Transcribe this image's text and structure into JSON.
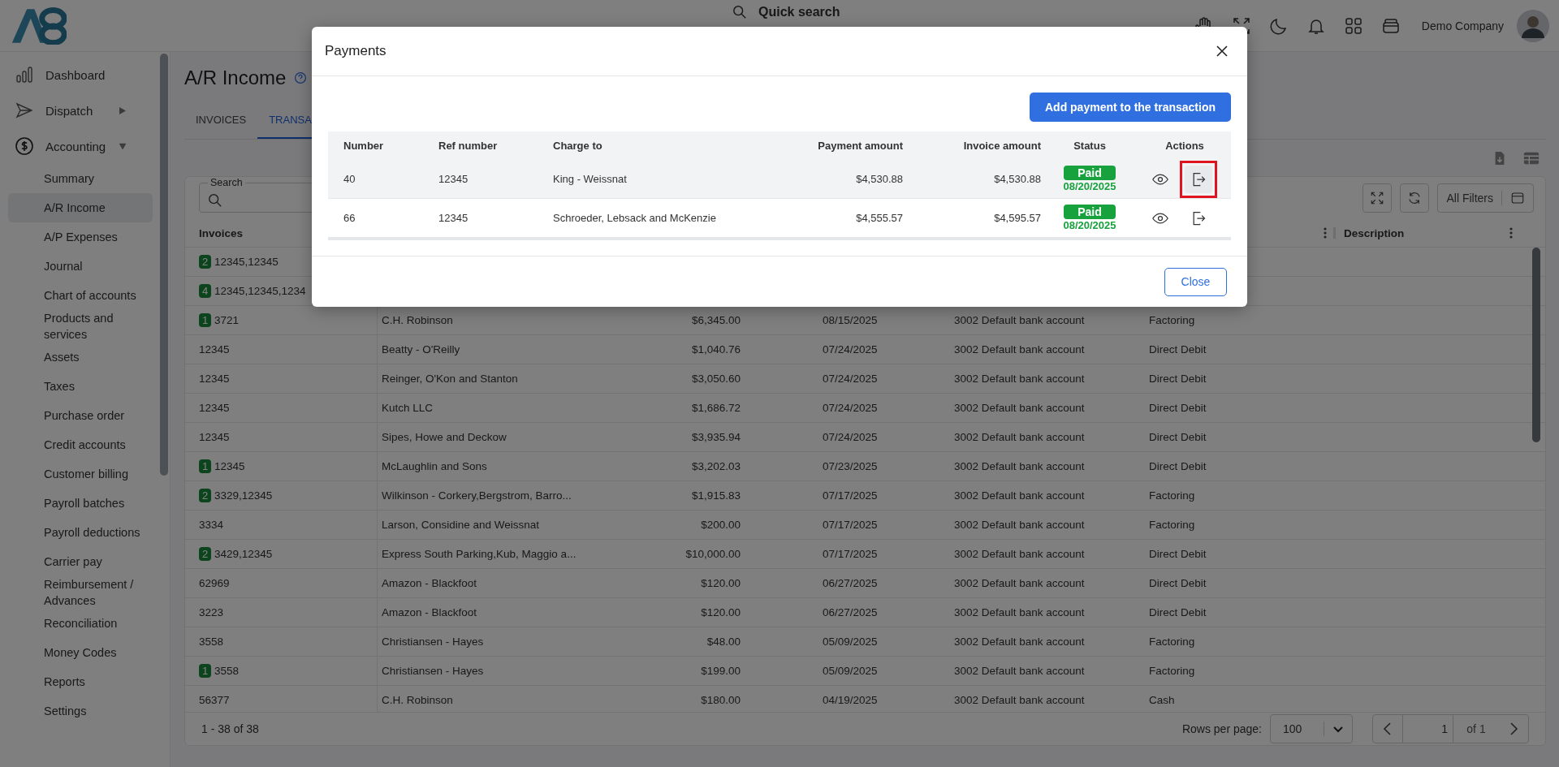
{
  "topbar": {
    "search_placeholder": "Quick search",
    "company": "Demo Company"
  },
  "sidebar": {
    "items": [
      {
        "label": "Dashboard"
      },
      {
        "label": "Dispatch",
        "expanded": false
      },
      {
        "label": "Accounting",
        "expanded": true,
        "children": [
          {
            "label": "Summary",
            "selected": false
          },
          {
            "label": "A/R Income",
            "selected": true
          },
          {
            "label": "A/P Expenses",
            "selected": false
          },
          {
            "label": "Journal",
            "selected": false
          },
          {
            "label": "Chart of accounts",
            "selected": false
          },
          {
            "label": "Products and services",
            "selected": false
          },
          {
            "label": "Assets",
            "selected": false
          },
          {
            "label": "Taxes",
            "selected": false
          },
          {
            "label": "Purchase order",
            "selected": false
          },
          {
            "label": "Credit accounts",
            "selected": false
          },
          {
            "label": "Customer billing",
            "selected": false
          },
          {
            "label": "Payroll batches",
            "selected": false
          },
          {
            "label": "Payroll deductions",
            "selected": false
          },
          {
            "label": "Carrier pay",
            "selected": false
          },
          {
            "label": "Reimbursement / Advances",
            "selected": false
          },
          {
            "label": "Reconciliation",
            "selected": false
          },
          {
            "label": "Money Codes",
            "selected": false
          },
          {
            "label": "Reports",
            "selected": false
          },
          {
            "label": "Settings",
            "selected": false
          }
        ]
      }
    ]
  },
  "page": {
    "title": "A/R Income",
    "tabs": [
      {
        "label": "INVOICES",
        "selected": false
      },
      {
        "label": "TRANSA",
        "selected": true
      }
    ]
  },
  "toolbar": {
    "search_label": "Search",
    "filters_button": "All Filters"
  },
  "table": {
    "columns": [
      {
        "label": "Invoices"
      },
      {
        "label": "Description"
      }
    ],
    "rows": [
      {
        "count": "2",
        "invoices": "12345,12345"
      },
      {
        "count": "4",
        "invoices": "12345,12345,1234"
      },
      {
        "count": "1",
        "invoices": "3721",
        "customer": "C.H. Robinson",
        "amount": "$6,345.00",
        "date": "08/15/2025",
        "account": "3002 Default bank account",
        "type": "Factoring"
      },
      {
        "invoices": "12345",
        "customer": "Beatty - O'Reilly",
        "amount": "$1,040.76",
        "date": "07/24/2025",
        "account": "3002 Default bank account",
        "type": "Direct Debit"
      },
      {
        "invoices": "12345",
        "customer": "Reinger, O'Kon and Stanton",
        "amount": "$3,050.60",
        "date": "07/24/2025",
        "account": "3002 Default bank account",
        "type": "Direct Debit"
      },
      {
        "invoices": "12345",
        "customer": "Kutch LLC",
        "amount": "$1,686.72",
        "date": "07/24/2025",
        "account": "3002 Default bank account",
        "type": "Direct Debit"
      },
      {
        "invoices": "12345",
        "customer": "Sipes, Howe and Deckow",
        "amount": "$3,935.94",
        "date": "07/24/2025",
        "account": "3002 Default bank account",
        "type": "Direct Debit"
      },
      {
        "count": "1",
        "invoices": "12345",
        "customer": "McLaughlin and Sons",
        "amount": "$3,202.03",
        "date": "07/23/2025",
        "account": "3002 Default bank account",
        "type": "Direct Debit"
      },
      {
        "count": "2",
        "invoices": "3329,12345",
        "customer": "Wilkinson - Corkery,Bergstrom, Barro...",
        "amount": "$1,915.83",
        "date": "07/17/2025",
        "account": "3002 Default bank account",
        "type": "Factoring"
      },
      {
        "invoices": "3334",
        "customer": "Larson, Considine and Weissnat",
        "amount": "$200.00",
        "date": "07/17/2025",
        "account": "3002 Default bank account",
        "type": "Factoring"
      },
      {
        "count": "2",
        "invoices": "3429,12345",
        "customer": "Express South Parking,Kub, Maggio a...",
        "amount": "$10,000.00",
        "date": "07/17/2025",
        "account": "3002 Default bank account",
        "type": "Direct Debit"
      },
      {
        "invoices": "62969",
        "customer": "Amazon - Blackfoot",
        "amount": "$120.00",
        "date": "06/27/2025",
        "account": "3002 Default bank account",
        "type": "Direct Debit"
      },
      {
        "invoices": "3223",
        "customer": "Amazon - Blackfoot",
        "amount": "$120.00",
        "date": "06/27/2025",
        "account": "3002 Default bank account",
        "type": "Direct Debit"
      },
      {
        "invoices": "3558",
        "customer": "Christiansen - Hayes",
        "amount": "$48.00",
        "date": "05/09/2025",
        "account": "3002 Default bank account",
        "type": "Factoring"
      },
      {
        "count": "1",
        "invoices": "3558",
        "customer": "Christiansen - Hayes",
        "amount": "$199.00",
        "date": "05/09/2025",
        "account": "3002 Default bank account",
        "type": "Factoring"
      },
      {
        "invoices": "56377",
        "customer": "C.H. Robinson",
        "amount": "$180.00",
        "date": "04/19/2025",
        "account": "3002 Default bank account",
        "type": "Cash"
      }
    ],
    "footer": {
      "range": "1 - 38 of 38",
      "rows_per_page_label": "Rows per page:",
      "rows_per_page": "100",
      "page": "1",
      "of_pages": "of 1"
    }
  },
  "modal": {
    "title": "Payments",
    "add_button": "Add payment to the transaction",
    "columns": [
      "Number",
      "Ref number",
      "Charge to",
      "Payment amount",
      "Invoice amount",
      "Status",
      "Actions"
    ],
    "rows": [
      {
        "number": "40",
        "ref": "12345",
        "charge_to": "King - Weissnat",
        "payment_amount": "$4,530.88",
        "invoice_amount": "$4,530.88",
        "status": "Paid",
        "status_date": "08/20/2025",
        "selected": true,
        "highlighted": true
      },
      {
        "number": "66",
        "ref": "12345",
        "charge_to": "Schroeder, Lebsack and McKenzie",
        "payment_amount": "$4,555.57",
        "invoice_amount": "$4,595.57",
        "status": "Paid",
        "status_date": "08/20/2025",
        "selected": false,
        "highlighted": false
      }
    ],
    "close_button": "Close"
  }
}
